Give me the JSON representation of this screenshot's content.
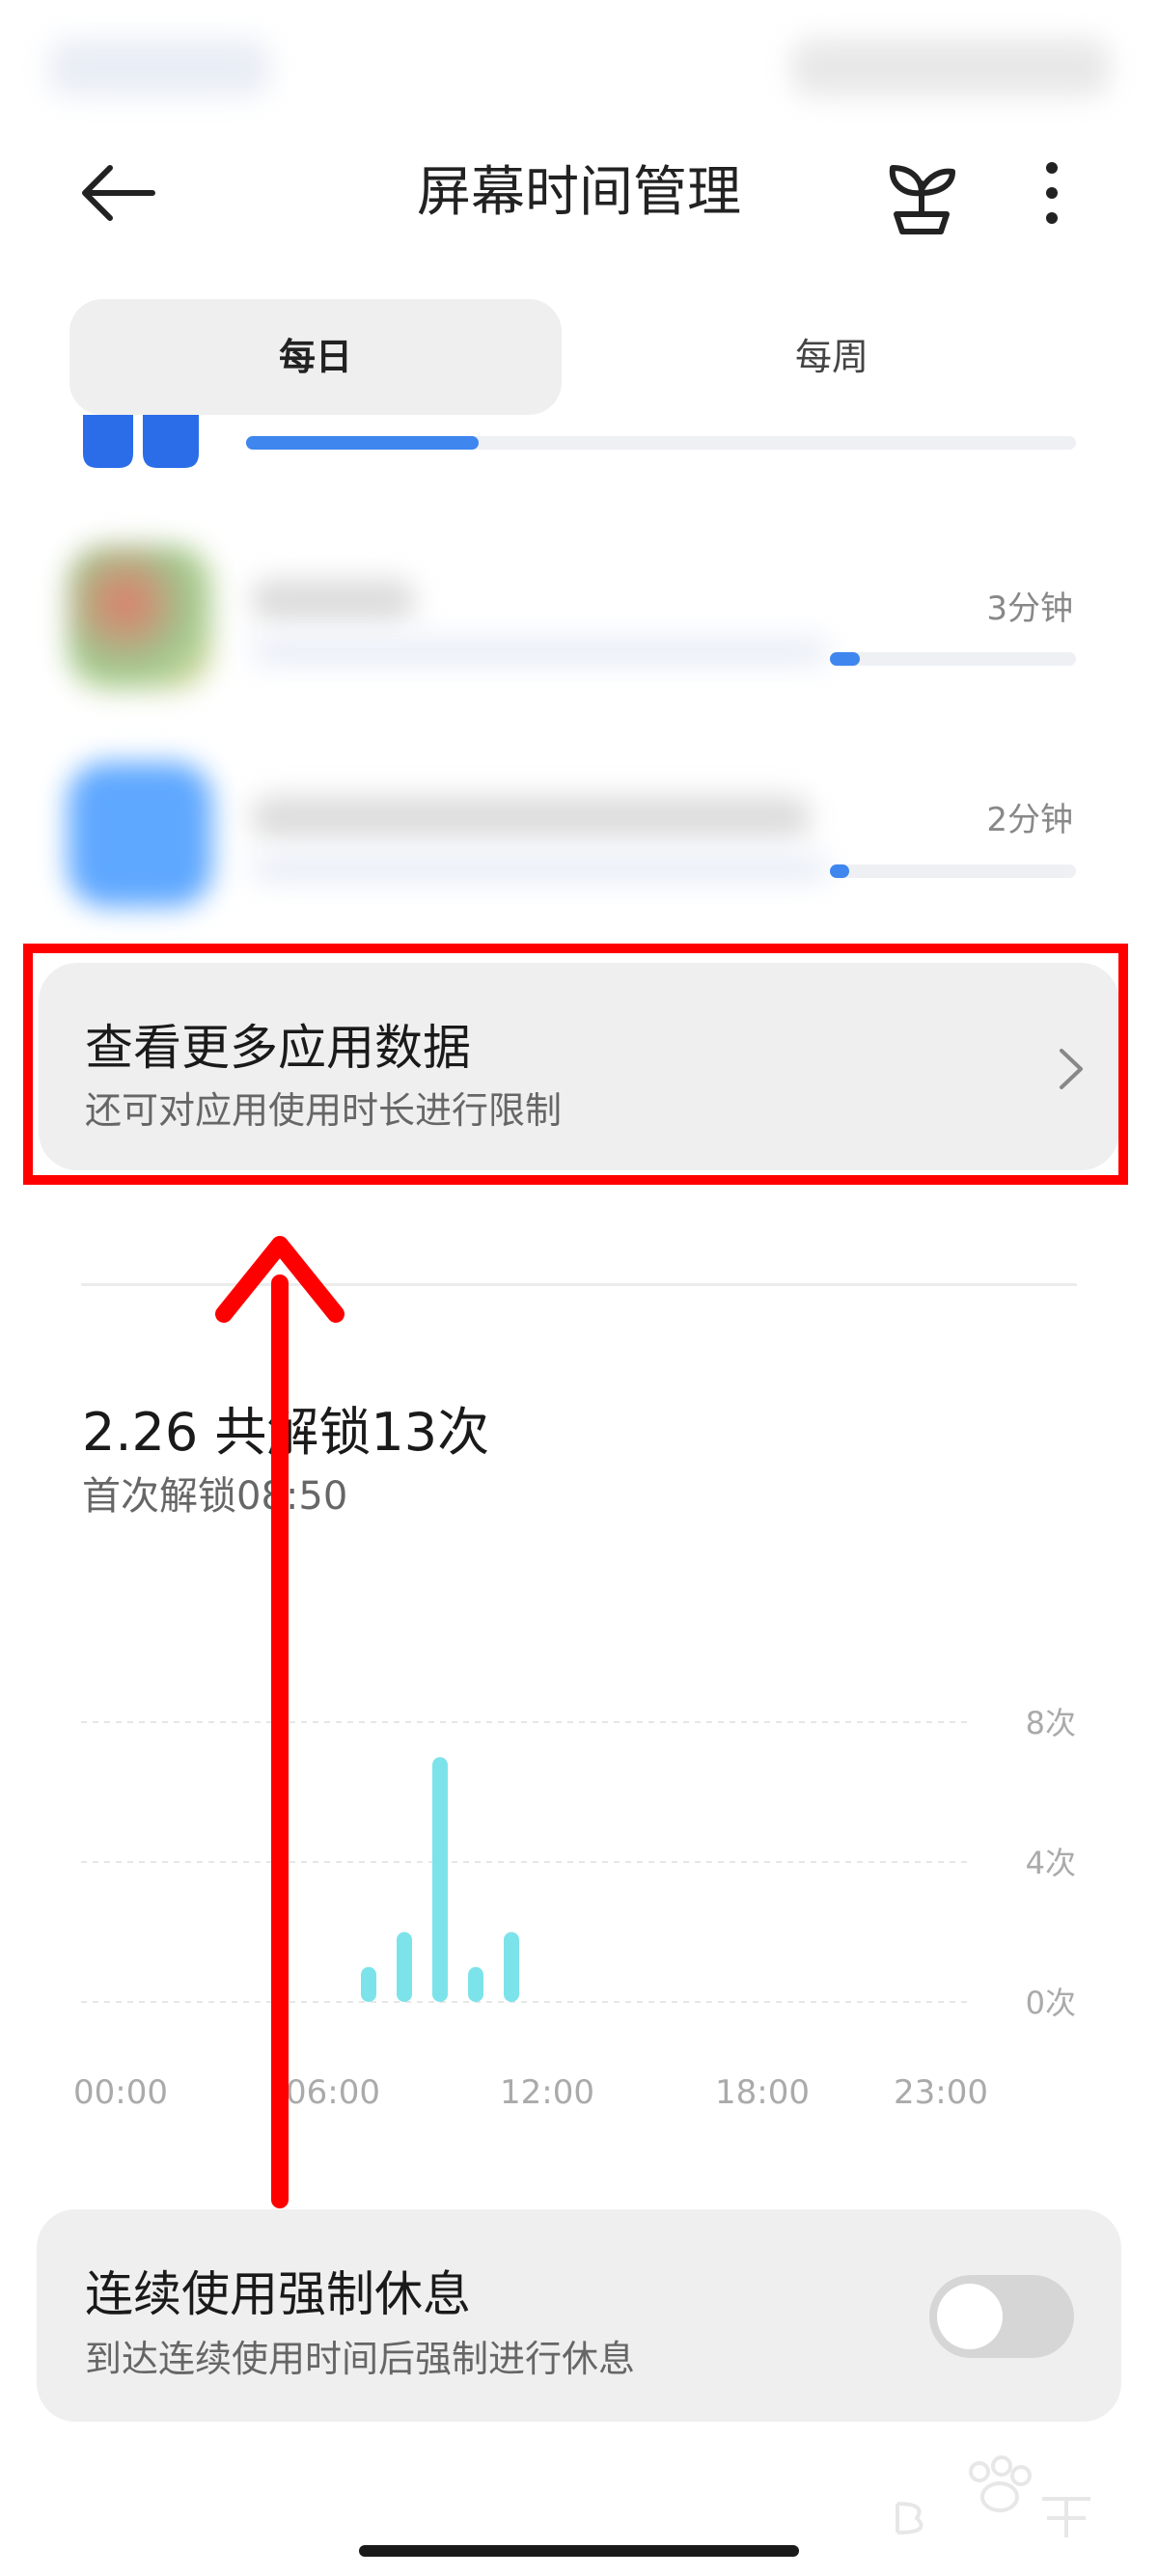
{
  "header": {
    "title": "屏幕时间管理",
    "back_icon": "arrow-left-icon",
    "plant_icon": "sprout-icon",
    "more_icon": "more-vertical-icon"
  },
  "tabs": [
    {
      "label": "每日",
      "selected": true
    },
    {
      "label": "每周",
      "selected": false
    }
  ],
  "apps": [
    {
      "time": "3分钟",
      "usage_fraction": 0.12,
      "icon_color": "#c9d8c8"
    },
    {
      "time": "2分钟",
      "usage_fraction": 0.08,
      "icon_color": "#5fa8ff"
    }
  ],
  "partial_app": {
    "usage_fraction": 0.28,
    "icon_color": "#2b6de8"
  },
  "more_apps": {
    "title": "查看更多应用数据",
    "subtitle": "还可对应用使用时长进行限制",
    "chevron_icon": "chevron-right-icon"
  },
  "unlock": {
    "summary": "2.26 共解锁13次",
    "first_unlock": "首次解锁08:50"
  },
  "chart_data": {
    "type": "bar",
    "x_range": [
      0,
      24
    ],
    "ylim": [
      0,
      8
    ],
    "y_ticks": [
      "8次",
      "4次",
      "0次"
    ],
    "y_tick_values": [
      8,
      4,
      0
    ],
    "x_ticks": [
      "00:00",
      "06:00",
      "12:00",
      "18:00",
      "23:00"
    ],
    "x_tick_values": [
      0,
      6,
      12,
      18,
      23
    ],
    "grid": true,
    "bar_color": "#7de3ea",
    "bars": [
      {
        "hour": 7,
        "value": 1
      },
      {
        "hour": 8,
        "value": 2
      },
      {
        "hour": 9,
        "value": 7
      },
      {
        "hour": 10,
        "value": 1
      },
      {
        "hour": 11,
        "value": 2
      }
    ]
  },
  "forced_break": {
    "title": "连续使用强制休息",
    "subtitle": "到达连续使用时间后强制进行休息",
    "enabled": false
  },
  "colors": {
    "accent": "#3f86ef",
    "annotation": "#ff0000",
    "card_bg": "#efefef"
  }
}
